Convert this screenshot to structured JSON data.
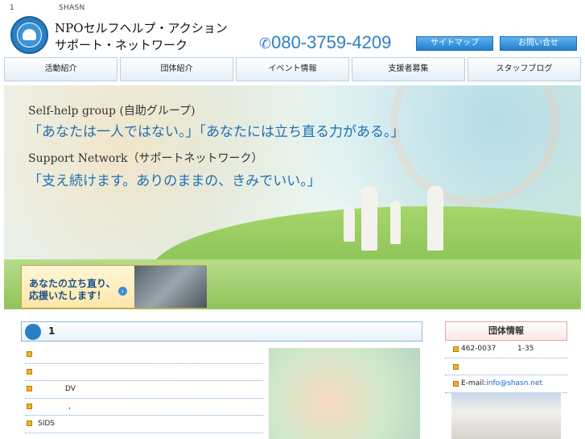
{
  "topline": {
    "page_number": "1",
    "site_code": "SHASN"
  },
  "header": {
    "org_line1": "NPOセルフヘルプ・アクション",
    "org_line2": "サポート・ネットワーク",
    "phone": "080-3759-4209",
    "sitemap_label": "サイトマップ",
    "contact_label": "お問い合せ"
  },
  "nav": {
    "items": [
      {
        "label": "活動紹介"
      },
      {
        "label": "団体紹介"
      },
      {
        "label": "イベント情報"
      },
      {
        "label": "支援者募集"
      },
      {
        "label": "スタッフブログ"
      }
    ]
  },
  "hero": {
    "line1": "Self-help group (自助グループ)",
    "line2": "「あなたは一人ではない。」「あなたには立ち直る力がある。」",
    "line3": "Support Network（サポートネットワーク）",
    "line4": "「支え続けます。ありのままの、きみでいい。」"
  },
  "banner": {
    "line1": "あなたの立ち直り、",
    "line2": "応援いたします！"
  },
  "section": {
    "title": "1"
  },
  "list": {
    "items": [
      {
        "text": ""
      },
      {
        "text": ""
      },
      {
        "text": "DV"
      },
      {
        "text": ","
      },
      {
        "text": "SIDS"
      }
    ]
  },
  "sidebar": {
    "title": "団体情報",
    "postal": "462-0037",
    "address": "1-35",
    "email_prefix": "E-mail:",
    "email": "info@shasn.net"
  }
}
